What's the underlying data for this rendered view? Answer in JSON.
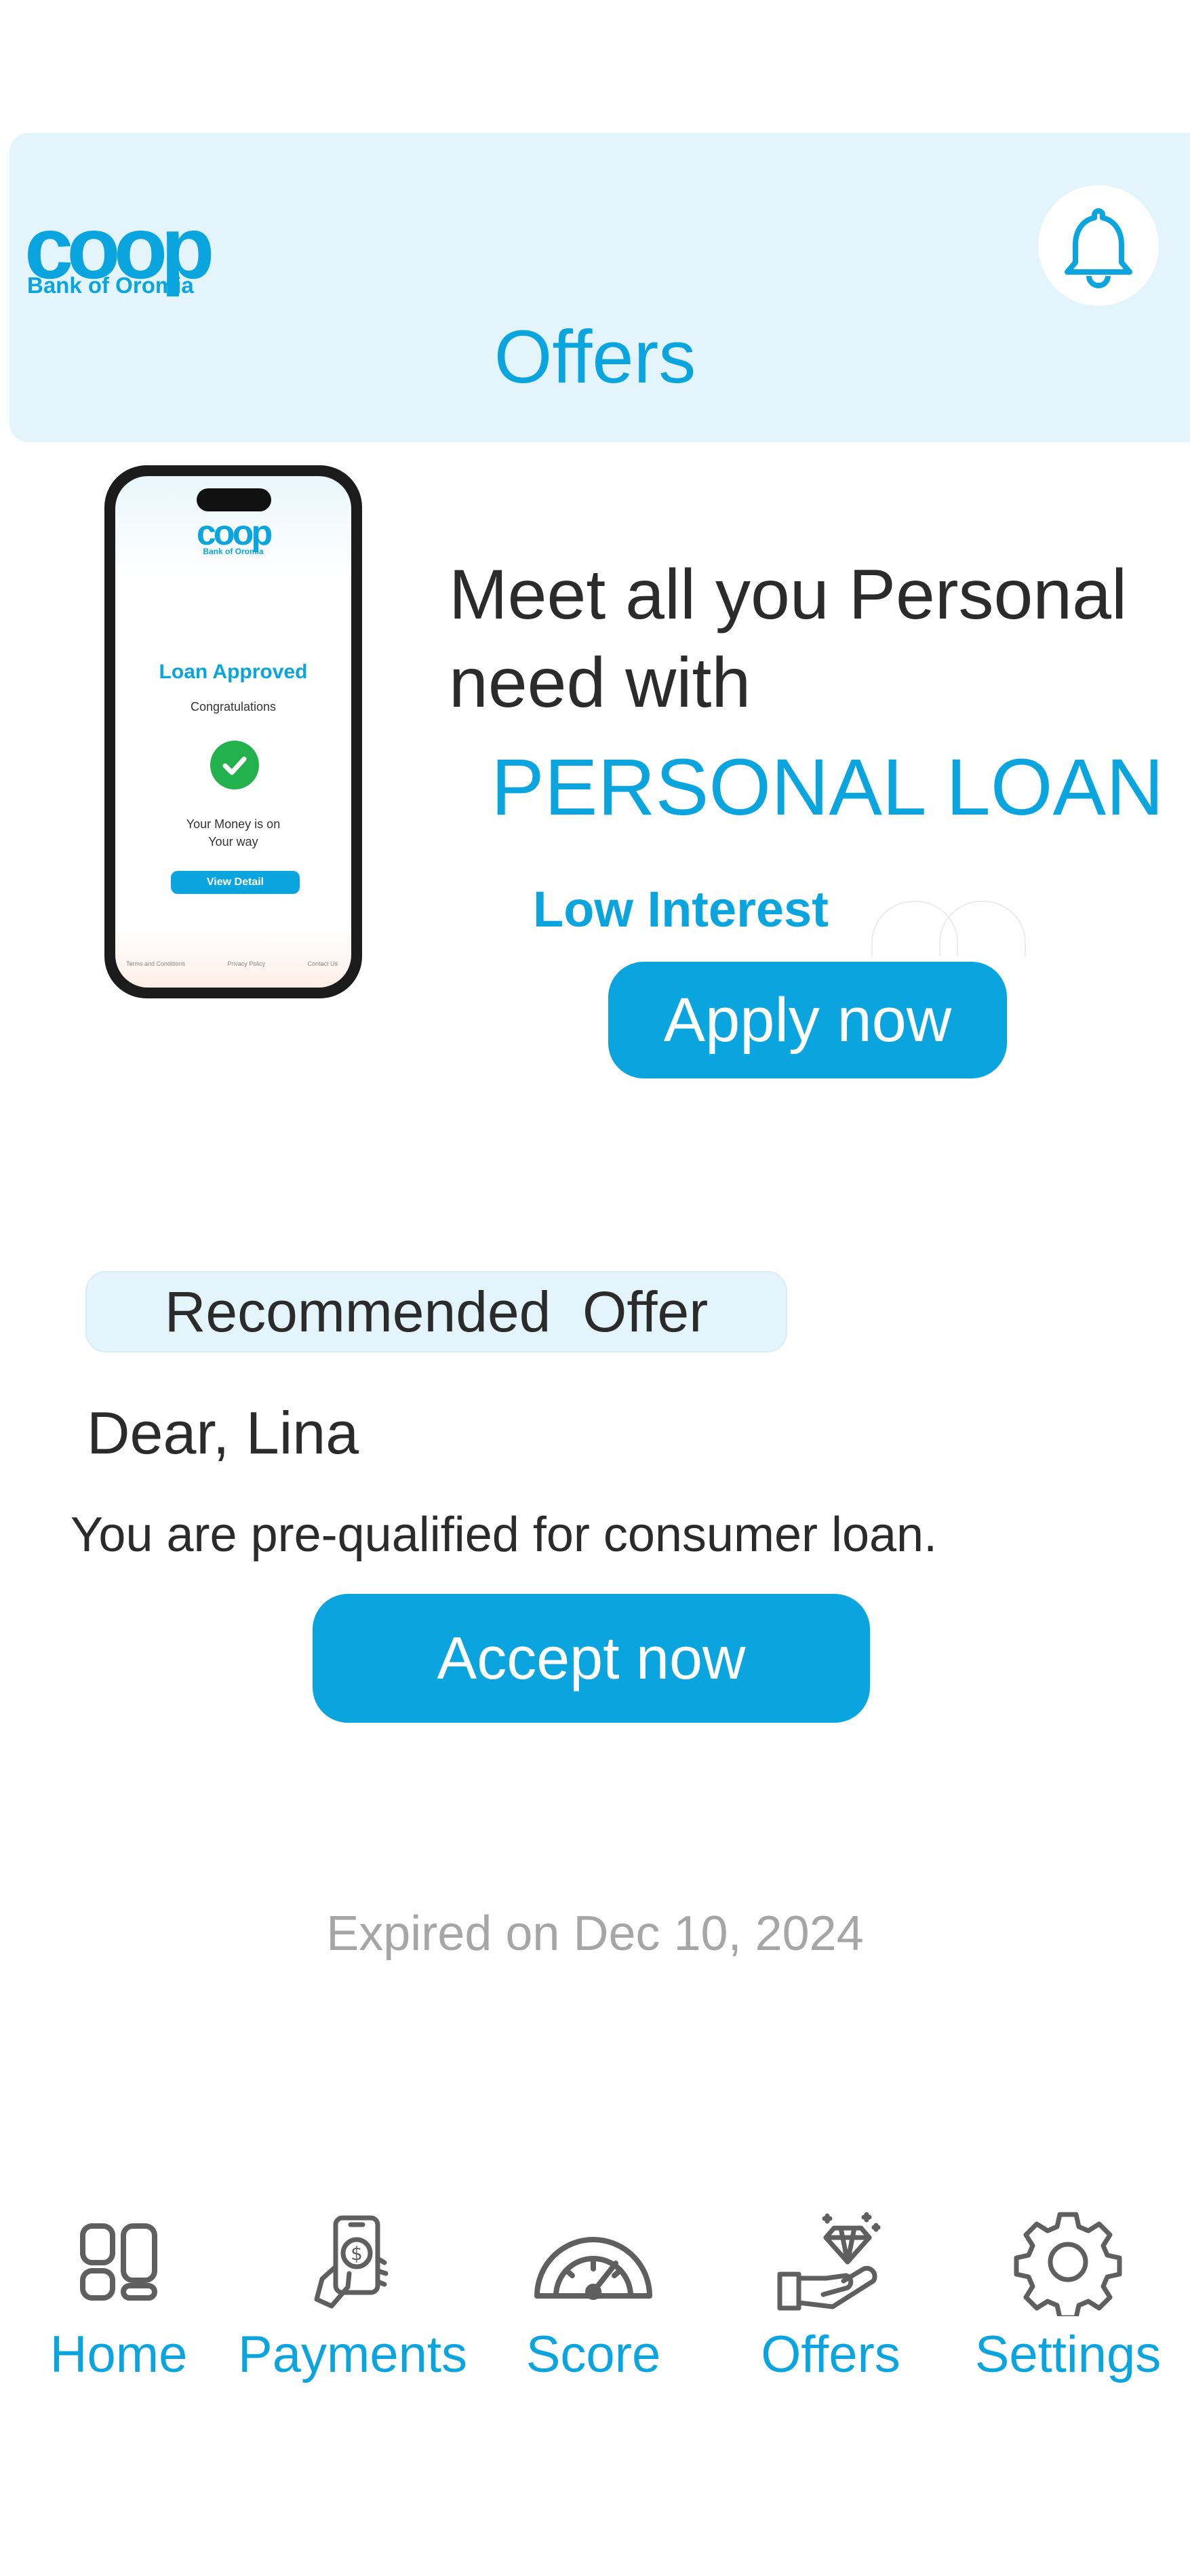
{
  "header": {
    "logo_text": "coop",
    "logo_subtitle": "Bank of Oromia",
    "notification_icon": "bell-icon",
    "title": "Offers"
  },
  "phone_preview": {
    "logo_text": "coop",
    "logo_subtitle": "Bank of Oromia",
    "heading": "Loan Approved",
    "subheading": "Congratulations",
    "check_icon": "check-circle-icon",
    "message_line1": "Your Money is on",
    "message_line2": "Your way",
    "button_label": "View Detail",
    "footer_links": [
      "Terms and Conditions",
      "Privacy Policy",
      "Contact Us"
    ]
  },
  "promo": {
    "line1": "Meet all you Personal",
    "line2": "need with",
    "highlight": "PERSONAL LOAN",
    "tagline": "Low Interest",
    "button_label": "Apply now"
  },
  "recommended": {
    "badge": "Recommended  Offer",
    "greeting": "Dear, Lina",
    "message": "You are pre-qualified for consumer loan.",
    "button_label": "Accept now",
    "expiry": "Expired on Dec 10, 2024"
  },
  "nav": {
    "items": [
      {
        "label": "Home",
        "icon": "home-grid-icon"
      },
      {
        "label": "Payments",
        "icon": "phone-payment-icon"
      },
      {
        "label": "Score",
        "icon": "gauge-icon"
      },
      {
        "label": "Offers",
        "icon": "hand-diamond-icon"
      },
      {
        "label": "Settings",
        "icon": "gear-icon"
      }
    ]
  },
  "colors": {
    "brand": "#0aa5df",
    "header_bg": "#e3f5fb",
    "text": "#2b2b2b",
    "muted": "#a6a6a6",
    "icon_gray": "#5f5f5f"
  }
}
